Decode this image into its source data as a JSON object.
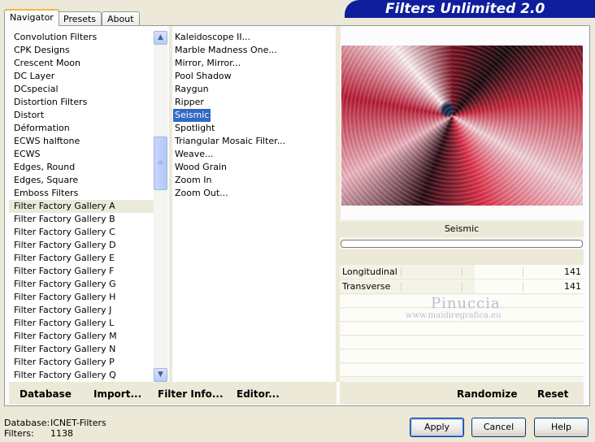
{
  "tabs": [
    "Navigator",
    "Presets",
    "About"
  ],
  "brand": {
    "title": "Filters Unlimited 2.0"
  },
  "categories": [
    "Convolution Filters",
    "CPK Designs",
    "Crescent Moon",
    "DC Layer",
    "DCspecial",
    "Distortion Filters",
    "Distort",
    "Déformation",
    "ECWS halftone",
    "ECWS",
    "Edges, Round",
    "Edges, Square",
    "Emboss Filters",
    "Filter Factory Gallery A",
    "Filter Factory Gallery B",
    "Filter Factory Gallery C",
    "Filter Factory Gallery D",
    "Filter Factory Gallery E",
    "Filter Factory Gallery F",
    "Filter Factory Gallery G",
    "Filter Factory Gallery H",
    "Filter Factory Gallery J",
    "Filter Factory Gallery L",
    "Filter Factory Gallery M",
    "Filter Factory Gallery N",
    "Filter Factory Gallery P",
    "Filter Factory Gallery Q"
  ],
  "selected_category": "Filter Factory Gallery A",
  "filters": [
    "Kaleidoscope II...",
    "Marble Madness One...",
    "Mirror, Mirror...",
    "Pool Shadow",
    "Raygun",
    "Ripper",
    "Seismic",
    "Spotlight",
    "Triangular Mosaic Filter...",
    "Weave...",
    "Wood Grain",
    "Zoom In",
    "Zoom Out..."
  ],
  "selected_filter": "Seismic",
  "current_filter_name": "Seismic",
  "parameters": [
    {
      "label": "Longitudinal",
      "value": 141,
      "max": 255
    },
    {
      "label": "Transverse",
      "value": 141,
      "max": 255
    }
  ],
  "watermark": {
    "name": "Pinuccia",
    "url": "www.maidiregrafica.eu"
  },
  "bottom_links": [
    "Database",
    "Import...",
    "Filter Info...",
    "Editor..."
  ],
  "right_links": [
    "Randomize",
    "Reset"
  ],
  "status": {
    "database_label": "Database:",
    "database_value": "ICNET-Filters",
    "filters_label": "Filters:",
    "filters_value": "1138"
  },
  "buttons": {
    "apply": "Apply",
    "cancel": "Cancel",
    "help": "Help"
  }
}
